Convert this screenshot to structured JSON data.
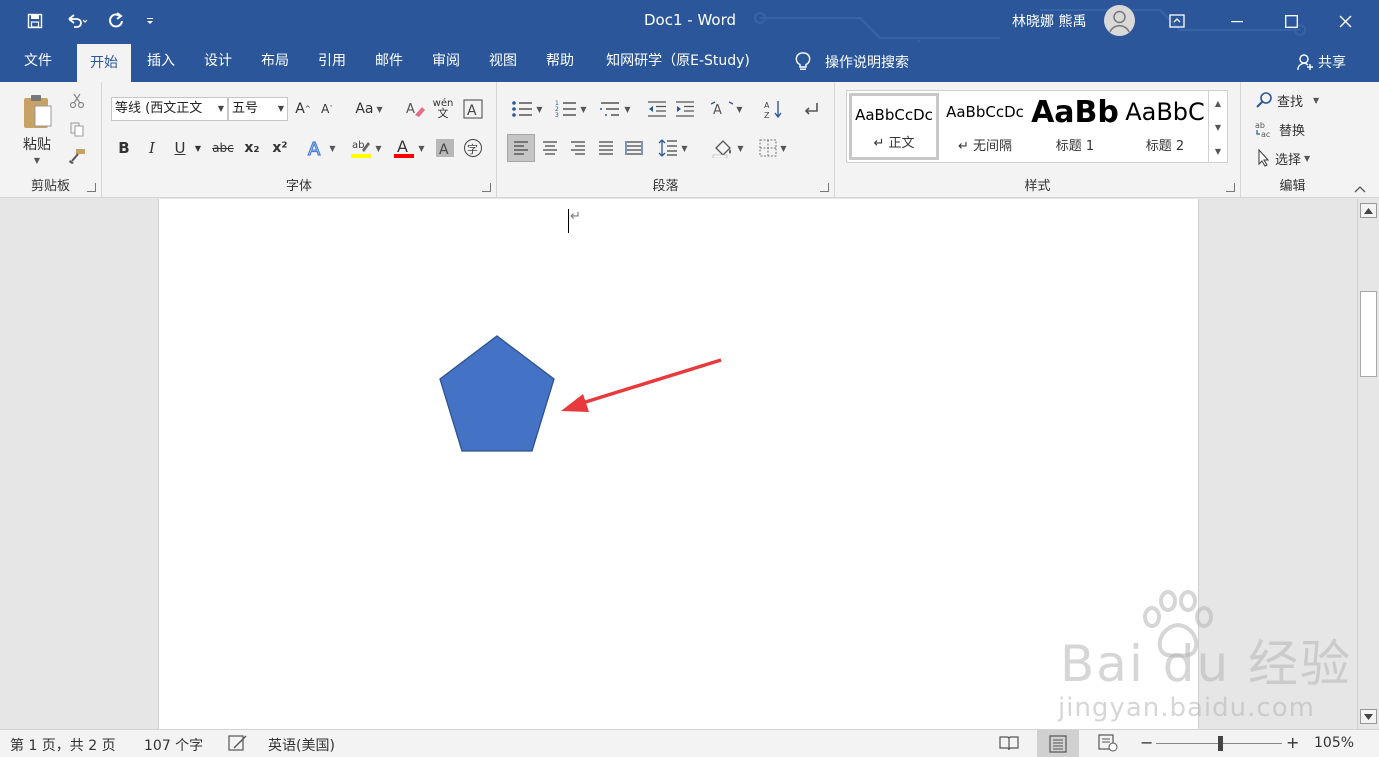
{
  "titlebar": {
    "title": "Doc1  -  Word",
    "user": "林晓娜 熊禹",
    "qat": [
      "save-icon",
      "undo-icon",
      "redo-icon",
      "customize-qat-icon"
    ],
    "window_controls": [
      "ribbon-display-icon",
      "minimize-icon",
      "maximize-icon",
      "close-icon"
    ]
  },
  "tabs": [
    "文件",
    "开始",
    "插入",
    "设计",
    "布局",
    "引用",
    "邮件",
    "审阅",
    "视图",
    "帮助",
    "知网研学（原E-Study)"
  ],
  "active_tab": "开始",
  "tell_me": "操作说明搜索",
  "share": "共享",
  "ribbon": {
    "clipboard": {
      "label": "剪贴板",
      "paste": "粘贴"
    },
    "font": {
      "label": "字体",
      "font_name": "等线 (西文正文",
      "font_size": "五号",
      "bold": "B",
      "italic": "I",
      "underline": "U",
      "strike": "abc",
      "sub": "x₂",
      "sup": "x²",
      "font_color": "#ff0000",
      "highlight_color": "#ffff00"
    },
    "paragraph": {
      "label": "段落"
    },
    "styles": {
      "label": "样式",
      "items": [
        {
          "preview": "AaBbCcDc",
          "name": "↵ 正文"
        },
        {
          "preview": "AaBbCcDc",
          "name": "↵ 无间隔"
        },
        {
          "preview": "AaBb",
          "name": "标题 1"
        },
        {
          "preview": "AaBbC",
          "name": "标题 2"
        }
      ]
    },
    "editing": {
      "label": "编辑",
      "find": "查找",
      "replace": "替换",
      "select": "选择"
    }
  },
  "document": {
    "paragraph_mark": "↵",
    "shape": {
      "type": "pentagon",
      "fill": "#4472c4",
      "stroke": "#2f528f"
    },
    "annotation_arrow_color": "#e8393c"
  },
  "statusbar": {
    "page": "第 1 页，共 2 页",
    "words": "107 个字",
    "language": "英语(美国)",
    "zoom": "105%",
    "zoom_level": 1.05
  },
  "watermark": {
    "brand": "Bai  du 经验",
    "url": "jingyan.baidu.com"
  }
}
